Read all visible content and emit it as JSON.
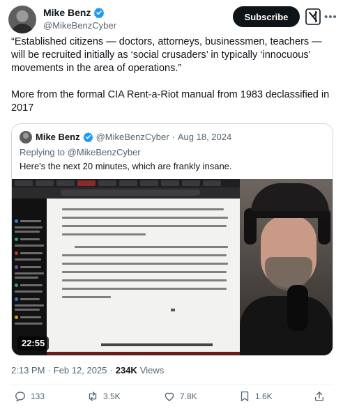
{
  "author": {
    "name": "Mike Benz",
    "handle": "@MikeBenzCyber"
  },
  "header": {
    "subscribe_label": "Subscribe",
    "grok_icon": "grok-icon",
    "more_icon": "more-icon"
  },
  "tweet": {
    "paragraph_1": "“Established citizens — doctors, attorneys, businessmen, teachers — will be recruited initially as ‘social crusaders’ in typically ‘innocuous’ movements in the area of operations.”",
    "paragraph_2": "More from the formal CIA Rent-a-Riot manual from 1983 declassified in 2017"
  },
  "quote": {
    "name": "Mike Benz",
    "handle": "@MikeBenzCyber",
    "separator": "·",
    "date": "Aug 18, 2024",
    "replying_to_prefix": "Replying to",
    "replying_to_handle": "@MikeBenzCyber",
    "text": "Here's the next 20 minutes, which are frankly insane.",
    "video_duration": "22:55"
  },
  "meta": {
    "time": "2:13 PM",
    "separator": "·",
    "date": "Feb 12, 2025",
    "separator_2": "·",
    "views_count": "234K",
    "views_label": "Views"
  },
  "actions": {
    "replies": "133",
    "reposts": "3.5K",
    "likes": "7.8K",
    "bookmarks": "1.6K"
  },
  "colors": {
    "text_primary": "#0f1419",
    "text_secondary": "#536471",
    "verified_blue": "#1d9bf0",
    "border": "#cfd9de"
  }
}
